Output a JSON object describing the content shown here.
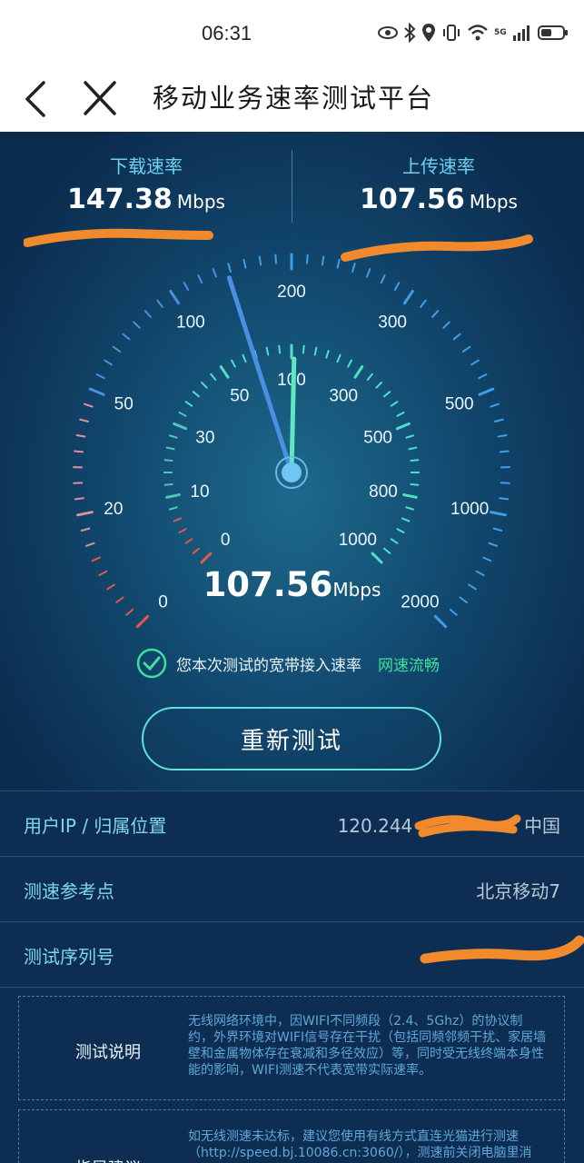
{
  "status_bar": {
    "time": "06:31",
    "network": "5G"
  },
  "header": {
    "title": "移动业务速率测试平台"
  },
  "rates": {
    "download": {
      "label": "下载速率",
      "value": "147.38",
      "unit": "Mbps"
    },
    "upload": {
      "label": "上传速率",
      "value": "107.56",
      "unit": "Mbps"
    }
  },
  "gauge": {
    "outer_ticks": [
      "0",
      "20",
      "50",
      "100",
      "200",
      "300",
      "500",
      "1000",
      "2000"
    ],
    "inner_ticks": [
      "0",
      "10",
      "30",
      "50",
      "100",
      "300",
      "500",
      "800",
      "1000"
    ],
    "outer_needle_value": 147.38,
    "inner_needle_value": 107.56,
    "colors": {
      "accent": "#4fe0c8",
      "warn": "#e05a4a",
      "needle_blue": "#4a8fe0"
    }
  },
  "current": {
    "value": "107.56",
    "unit": "Mbps"
  },
  "verdict": {
    "text": "您本次测试的宽带接入速率",
    "status": "网速流畅"
  },
  "retest_label": "重新测试",
  "info": {
    "ip": {
      "label": "用户IP / 归属位置",
      "value": "120.244",
      "location": "中国"
    },
    "node": {
      "label": "测速参考点",
      "value": "北京移动7"
    },
    "serial": {
      "label": "测试序列号",
      "value": ""
    }
  },
  "notes": {
    "test_desc": {
      "label": "测试说明",
      "text": "无线网络环境中，因WIFI不同频段（2.4、5Ghz）的协议制约，外界环境对WIFI信号存在干扰（包括同频邻频干扰、家居墙壁和金属物体存在衰减和多径效应）等，同时受无线终端本身性能的影响，WIFI测速不代表宽带实际速率。"
    },
    "advice": {
      "label": "指导建议",
      "text": "如无线测速未达标，建议您使用有线方式直连光猫进行测速（http://speed.bj.10086.cn:3060/），测速前关闭电脑里消"
    }
  }
}
